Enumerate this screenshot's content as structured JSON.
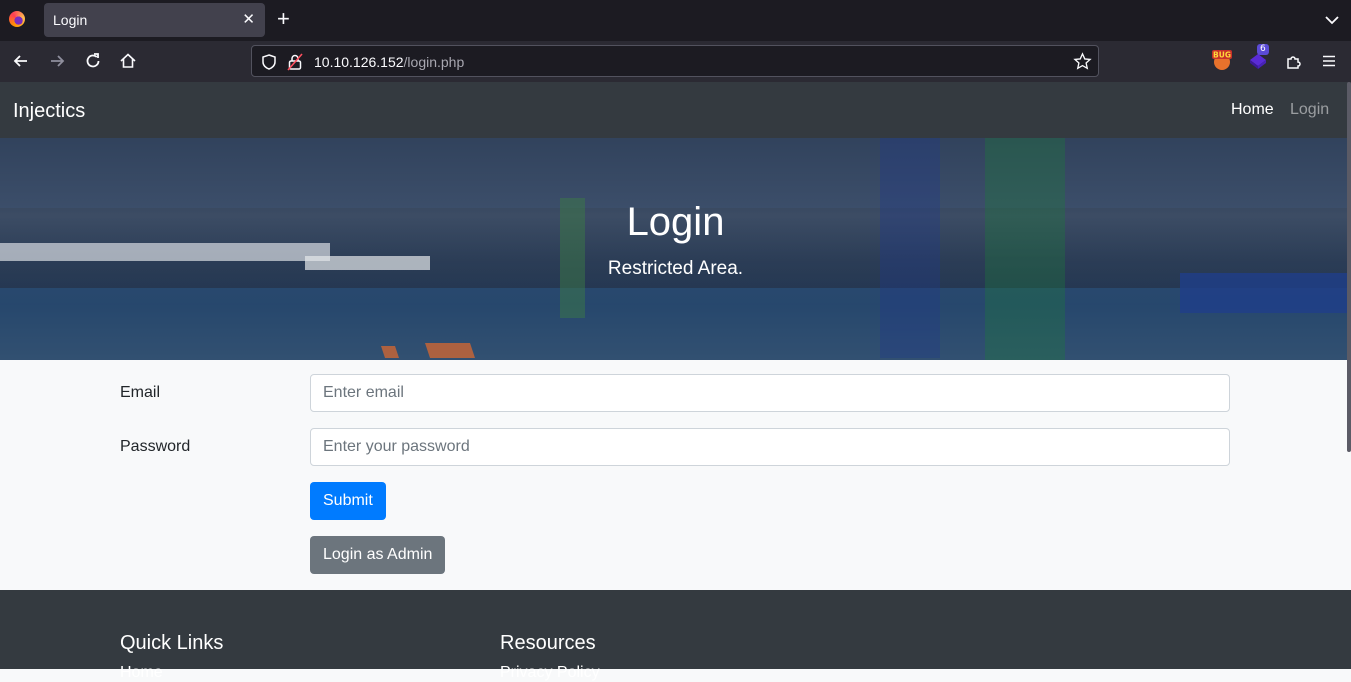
{
  "browser": {
    "tab_title": "Login",
    "url_host": "10.10.126.152",
    "url_path": "/login.php",
    "ext_badge_count": "6"
  },
  "site": {
    "brand": "Injectics",
    "nav": [
      "Home",
      "Login"
    ],
    "hero_title": "Login",
    "hero_subtitle": "Restricted Area."
  },
  "form": {
    "email_label": "Email",
    "email_placeholder": "Enter email",
    "password_label": "Password",
    "password_placeholder": "Enter your password",
    "submit_label": "Submit",
    "admin_label": "Login as Admin"
  },
  "footer": {
    "col1_heading": "Quick Links",
    "col2_heading": "Resources",
    "col1_first": "Home",
    "col2_first": "Privacy Policy"
  },
  "colors": {
    "primary": "#007bff",
    "secondary": "#6c757d",
    "dark": "#343a40"
  }
}
